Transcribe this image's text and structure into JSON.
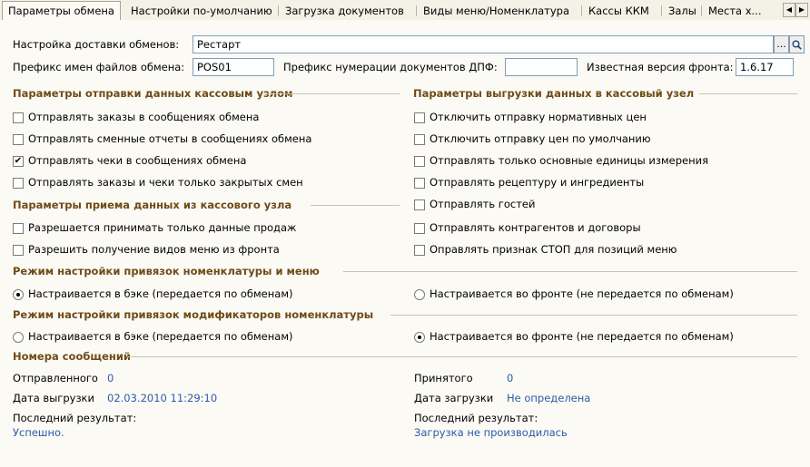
{
  "tabs": [
    {
      "label": "Параметры обмена",
      "active": true
    },
    {
      "label": "Настройки по-умолчанию"
    },
    {
      "label": "Загрузка документов"
    },
    {
      "label": "Виды меню/Номенклатура"
    },
    {
      "label": "Кассы ККМ"
    },
    {
      "label": "Залы"
    },
    {
      "label": "Места х..."
    }
  ],
  "tab_scroll": {
    "left_icon": "◀",
    "right_icon": "▶"
  },
  "delivery": {
    "label": "Настройка доставки обменов:",
    "value": "Рестарт",
    "select_icon": "...",
    "search_icon": "magnifier-icon"
  },
  "prefix": {
    "label": "Префикс имен файлов обмена:",
    "value": "POS01"
  },
  "doc_prefix": {
    "label": "Префикс нумерации документов ДПФ:",
    "value": ""
  },
  "front_version": {
    "label": "Известная версия фронта:",
    "value": "1.6.17"
  },
  "send_section": {
    "title": "Параметры отправки данных кассовым узлом",
    "items": [
      {
        "label": "Отправлять заказы в сообщениях обмена",
        "checked": false
      },
      {
        "label": "Отправлять сменные отчеты в сообщениях обмена",
        "checked": false
      },
      {
        "label": "Отправлять чеки в сообщениях обмена",
        "checked": true
      },
      {
        "label": "Отправлять заказы и чеки только закрытых смен",
        "checked": false
      }
    ]
  },
  "receive_section": {
    "title": "Параметры приема данных из кассового узла",
    "items": [
      {
        "label": "Разрешается принимать только данные продаж",
        "checked": false
      },
      {
        "label": "Разрешить получение видов меню из фронта",
        "checked": false
      }
    ]
  },
  "export_section": {
    "title": "Параметры выгрузки данных в кассовый узел",
    "items": [
      {
        "label": "Отключить отправку нормативных цен",
        "checked": false
      },
      {
        "label": "Отключить отправку цен по умолчанию",
        "checked": false
      },
      {
        "label": "Отправлять только основные единицы измерения",
        "checked": false
      },
      {
        "label": "Отправлять рецептуру и ингредиенты",
        "checked": false
      },
      {
        "label": "Отправлять гостей",
        "checked": false
      },
      {
        "label": "Отправлять контрагентов и договоры",
        "checked": false
      },
      {
        "label": "Оправлять признак СТОП для позиций меню",
        "checked": false
      }
    ]
  },
  "nomenclature_mode": {
    "title": "Режим настройки привязок номенклатуры и меню",
    "back_label": "Настраивается в бэке (передается по обменам)",
    "front_label": "Настраивается во фронте (не передается по обменам)",
    "selected": "back"
  },
  "modifier_mode": {
    "title": "Режим настройки привязок модификаторов номенклатуры",
    "back_label": "Настраивается в бэке (передается по обменам)",
    "front_label": "Настраивается во фронте (не передается по обменам)",
    "selected": "front"
  },
  "messages": {
    "title": "Номера сообщений",
    "sent_label": "Отправленного",
    "sent_value": "0",
    "export_date_label": "Дата выгрузки",
    "export_date_value": "02.03.2010 11:29:10",
    "sent_result_label": "Последний результат:",
    "sent_result_value": "Успешно.",
    "received_label": "Принятого",
    "received_value": "0",
    "import_date_label": "Дата загрузки",
    "import_date_value": "Не определена",
    "received_result_label": "Последний результат:",
    "received_result_value": "Загрузка не производилась"
  },
  "colors": {
    "section_title": "#6e4b16",
    "link_value": "#2c5ba9",
    "panel_bg": "#fbfaf5"
  }
}
